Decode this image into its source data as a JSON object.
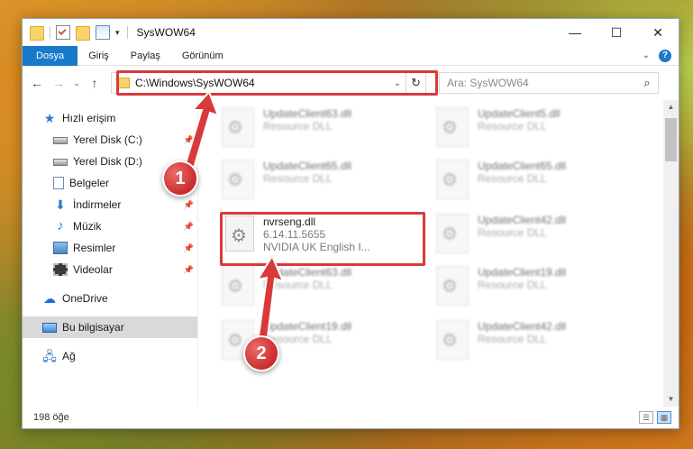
{
  "window": {
    "title": "SysWOW64",
    "controls": {
      "minimize": "—",
      "maximize": "☐",
      "close": "✕"
    }
  },
  "ribbon": {
    "tabs": [
      "Dosya",
      "Giriş",
      "Paylaş",
      "Görünüm"
    ],
    "help": "?"
  },
  "nav": {
    "back": "←",
    "forward": "→",
    "recent": "⌄",
    "up": "↑"
  },
  "address": {
    "path": "C:\\Windows\\SysWOW64",
    "dropdown": "⌄",
    "refresh": "↻"
  },
  "search": {
    "placeholder": "Ara: SysWOW64",
    "icon": "search-icon"
  },
  "sidebar": {
    "items": [
      {
        "label": "Hızlı erişim",
        "icon": "quick-access-star-icon",
        "pinned": false,
        "indent": false
      },
      {
        "label": "Yerel Disk (C:)",
        "icon": "drive-icon",
        "pinned": true,
        "indent": true
      },
      {
        "label": "Yerel Disk (D:)",
        "icon": "drive-icon",
        "pinned": true,
        "indent": true
      },
      {
        "label": "Belgeler",
        "icon": "documents-icon",
        "pinned": true,
        "indent": true
      },
      {
        "label": "İndirmeler",
        "icon": "downloads-icon",
        "pinned": true,
        "indent": true
      },
      {
        "label": "Müzik",
        "icon": "music-icon",
        "pinned": true,
        "indent": true
      },
      {
        "label": "Resimler",
        "icon": "pictures-icon",
        "pinned": true,
        "indent": true
      },
      {
        "label": "Videolar",
        "icon": "videos-icon",
        "pinned": true,
        "indent": true
      },
      {
        "label": "OneDrive",
        "icon": "onedrive-icon",
        "pinned": false,
        "indent": false
      },
      {
        "label": "Bu bilgisayar",
        "icon": "this-pc-icon",
        "pinned": false,
        "indent": false,
        "selected": true
      },
      {
        "label": "Ağ",
        "icon": "network-icon",
        "pinned": false,
        "indent": false
      }
    ]
  },
  "files": {
    "column1": [
      {
        "name": "UpdateClient63.dll",
        "sub": "Resource DLL",
        "blurred": true
      },
      {
        "name": "UpdateClient65.dll",
        "sub": "Resource DLL",
        "blurred": true
      },
      {
        "name": "nvrseng.dll",
        "sub": "6.14.11.5655",
        "sub2": "NVIDIA UK English I...",
        "blurred": false,
        "highlighted": true
      },
      {
        "name": "UpdateClient63.dll",
        "sub": "Resource DLL",
        "blurred": true
      },
      {
        "name": "UpdateClient19.dll",
        "sub": "Resource DLL",
        "blurred": true
      }
    ],
    "column2": [
      {
        "name": "UpdateClient5.dll",
        "sub": "Resource DLL",
        "blurred": true
      },
      {
        "name": "UpdateClient65.dll",
        "sub": "Resource DLL",
        "blurred": true
      },
      {
        "name": "UpdateClient42.dll",
        "sub": "Resource DLL",
        "blurred": true
      },
      {
        "name": "UpdateClient19.dll",
        "sub": "Resource DLL",
        "blurred": true
      },
      {
        "name": "UpdateClient42.dll",
        "sub": "Resource DLL",
        "blurred": true
      }
    ]
  },
  "status": {
    "count": "198 öğe"
  },
  "annotations": {
    "step1": "1",
    "step2": "2",
    "color": "#d83a3a"
  }
}
